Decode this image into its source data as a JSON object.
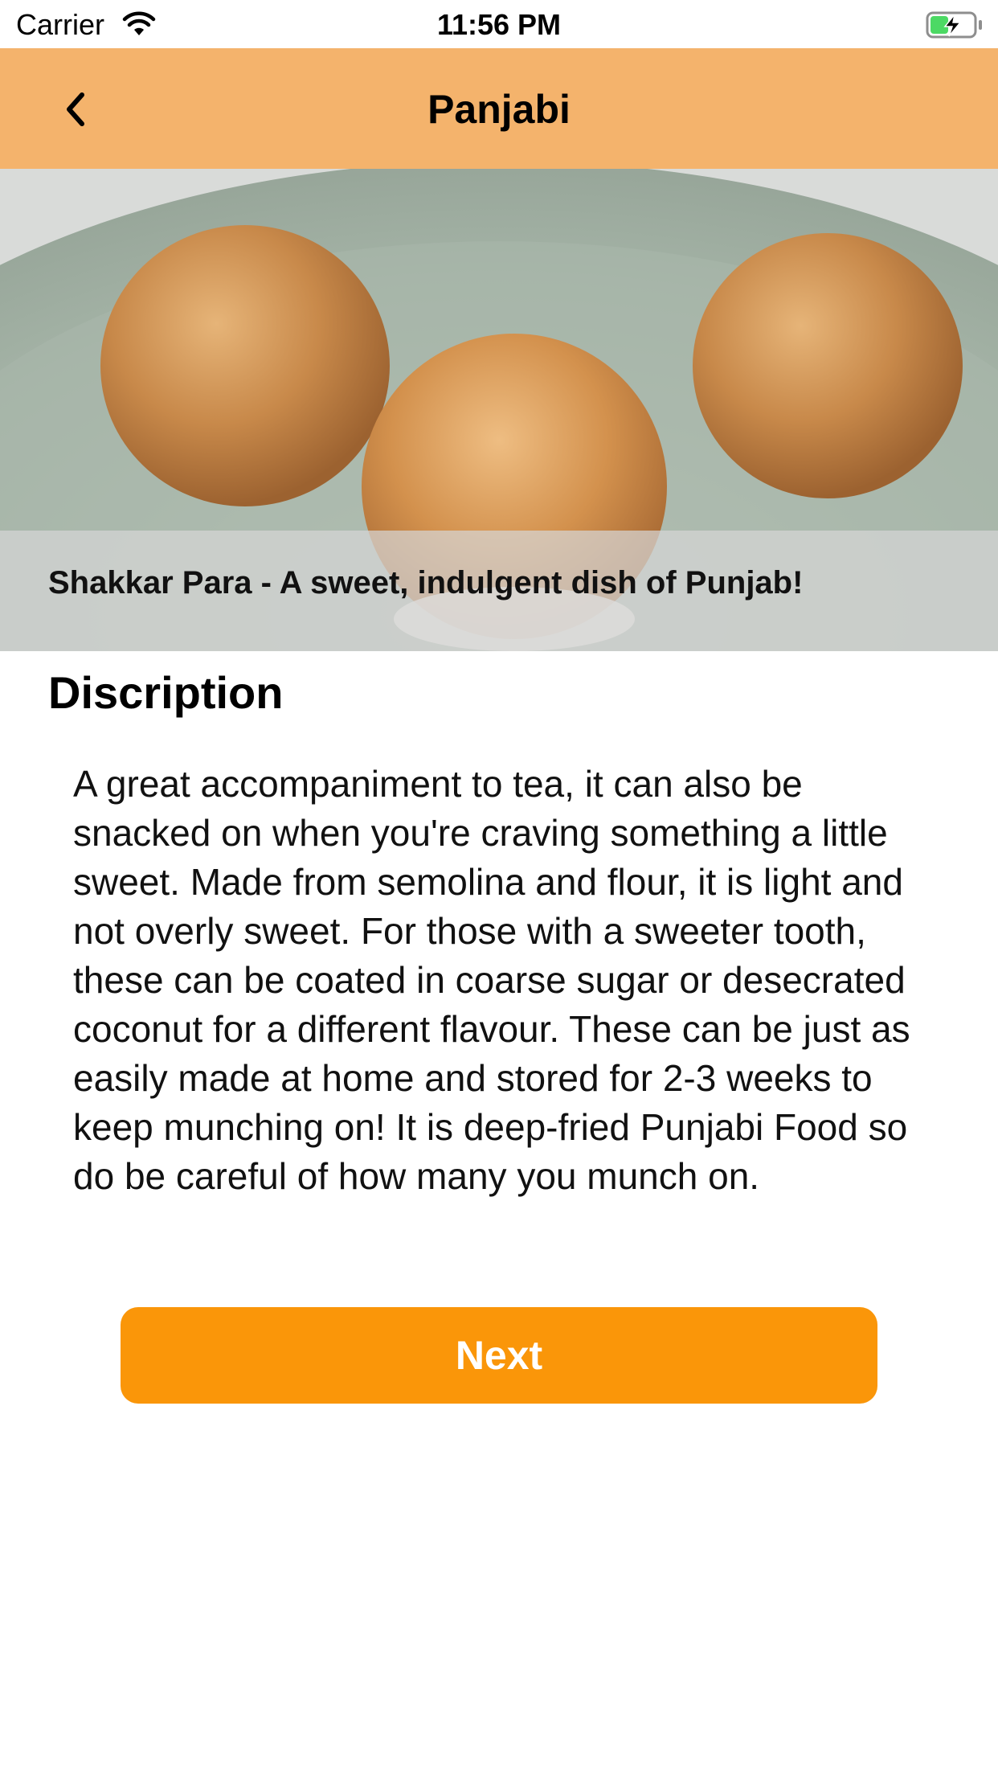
{
  "status_bar": {
    "carrier": "Carrier",
    "time": "11:56 PM",
    "wifi_icon": "wifi-icon",
    "battery_icon": "battery-charging-icon"
  },
  "nav_bar": {
    "title": "Panjabi",
    "back_icon": "chevron-left-icon",
    "background_color": "#f4b36c"
  },
  "hero": {
    "image_subject": "three shakkar para sweet balls on a pale green plate",
    "caption": "Shakkar Para - A sweet, indulgent dish of Punjab!"
  },
  "description": {
    "heading": "Discription",
    "body": "A great accompaniment to tea, it can also be snacked on when you're craving something a little sweet. Made from semolina and flour, it is light and not overly sweet. For those with a sweeter tooth, these can be coated in coarse sugar or desecrated coconut for a different flavour. These can be just as easily made at home and stored for 2-3 weeks to keep munching on! It is deep-fried Punjabi Food so do be careful of how many you munch on."
  },
  "actions": {
    "next_label": "Next",
    "next_color": "#fa9609"
  }
}
